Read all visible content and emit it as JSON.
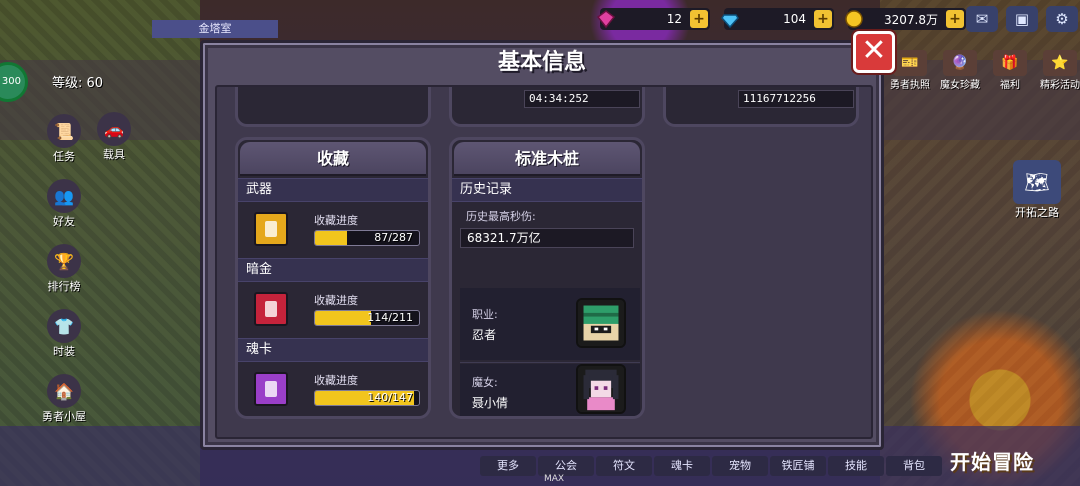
{
  "hud": {
    "gems": "12",
    "diamonds": "104",
    "gold": "3207.8万",
    "level": "等级: 60",
    "exp_badge": "300",
    "ribbon": "金塔室",
    "plus": "+"
  },
  "top_icons": [
    "mail-icon",
    "photo-icon",
    "settings-icon"
  ],
  "left_menu": [
    {
      "label": "任务",
      "icon": "task-scroll-icon",
      "glyph": "📜"
    },
    {
      "label": "好友",
      "icon": "friends-icon",
      "glyph": "👥"
    },
    {
      "label": "排行榜",
      "icon": "leaderboard-icon",
      "glyph": "🏆"
    },
    {
      "label": "时装",
      "icon": "costume-icon",
      "glyph": "👕"
    },
    {
      "label": "勇者小屋",
      "icon": "hut-icon",
      "glyph": "🏠"
    }
  ],
  "vehicle": {
    "label": "载具",
    "icon": "vehicle-icon",
    "glyph": "🚗"
  },
  "right_menu": [
    {
      "label": "勇者执照",
      "glyph": "🎫"
    },
    {
      "label": "魔女珍藏",
      "glyph": "🔮"
    },
    {
      "label": "福利",
      "glyph": "🎁"
    },
    {
      "label": "精彩活动",
      "glyph": "⭐"
    }
  ],
  "pioneer": {
    "label": "开拓之路",
    "glyph": "🗺"
  },
  "start_button": "开始冒险",
  "bottom_bar": [
    "更多",
    "公会",
    "符文",
    "魂卡",
    "宠物",
    "铁匠铺",
    "技能",
    "背包"
  ],
  "max_label": "MAX",
  "modal": {
    "title": "基本信息",
    "close": "✕",
    "top_values": [
      "04:34:252",
      "11167712256"
    ],
    "collection": {
      "title": "收藏",
      "rows": [
        {
          "name": "武器",
          "label": "收藏进度",
          "current": 87,
          "total": 287,
          "text": "87/287",
          "color": "#e5a81c"
        },
        {
          "name": "暗金",
          "label": "收藏进度",
          "current": 114,
          "total": 211,
          "text": "114/211",
          "color": "#c5233b"
        },
        {
          "name": "魂卡",
          "label": "收藏进度",
          "current": 140,
          "total": 147,
          "text": "140/147",
          "color": "#9a3fc8"
        }
      ]
    },
    "dummy": {
      "title": "标准木桩",
      "history_title": "历史记录",
      "max_dps_label": "历史最高秒伤:",
      "max_dps_value": "68321.7万亿",
      "job_label": "职业:",
      "job_value": "忍者",
      "witch_label": "魔女:",
      "witch_value": "聂小倩"
    }
  },
  "colors": {
    "modal_bg": "#544d63",
    "panel_bg": "#2b2735",
    "progress_fill": "#f2c51d",
    "close_red": "#d93a3a"
  }
}
